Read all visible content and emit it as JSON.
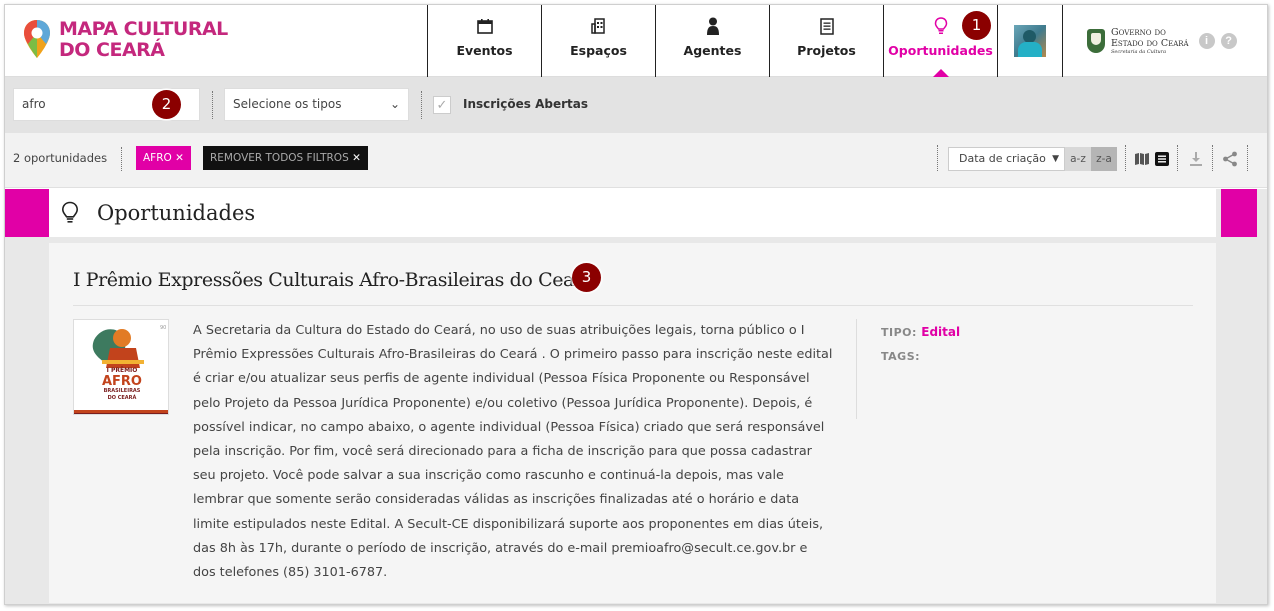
{
  "header": {
    "logo_line1": "MAPA CULTURAL",
    "logo_line2": "DO CEARÁ",
    "nav": [
      {
        "label": "Eventos",
        "icon": "calendar-icon"
      },
      {
        "label": "Espaços",
        "icon": "building-icon"
      },
      {
        "label": "Agentes",
        "icon": "person-icon"
      },
      {
        "label": "Projetos",
        "icon": "document-icon"
      },
      {
        "label": "Oportunidades",
        "icon": "lightbulb-icon",
        "active": true
      }
    ],
    "gov_line1": "Governo do",
    "gov_line2": "Estado do Ceará",
    "gov_line3": "Secretaria da Cultura",
    "info_icon": "i",
    "help_icon": "?"
  },
  "filters": {
    "search_value": "afro",
    "types_placeholder": "Selecione os tipos",
    "open_label": "Inscrições Abertas",
    "open_checked": true
  },
  "results": {
    "count_text": "2 oportunidades",
    "chip_afro": "AFRO",
    "chip_clear": "REMOVER TODOS FILTROS",
    "sort_label": "Data de criação",
    "sort_az": "a-z",
    "sort_za": "z-a"
  },
  "section": {
    "title": "Oportunidades"
  },
  "opportunity": {
    "title": "I Prêmio Expressões Culturais Afro-Brasileiras do Ceará",
    "thumb_number": "90",
    "thumb_line1": "I PRÊMIO",
    "thumb_line2": "AFRO",
    "thumb_line3": "BRASILEIRAS",
    "thumb_line4": "DO CEARÁ",
    "description": "A Secretaria da Cultura do Estado do Ceará, no uso de suas atribuições legais, torna público o  I Prêmio Expressões Culturais Afro-Brasileiras do Ceará . O primeiro passo para inscrição neste edital é criar e/ou atualizar seus perfis de agente individual (Pessoa Física Proponente ou Responsável pelo Projeto da Pessoa Jurídica Proponente) e/ou coletivo (Pessoa Jurídica Proponente). Depois, é possível indicar, no campo abaixo, o agente individual (Pessoa Física) criado que será responsável pela inscrição. Por fim, você será direcionado para a ficha de inscrição para que possa cadastrar seu projeto. Você pode salvar a sua inscrição como rascunho e continuá-la depois, mas vale lembrar que somente serão consideradas válidas as inscrições finalizadas até o horário e data limite estipulados neste Edital. A Secult-CE disponibilizará suporte aos proponentes em dias úteis, das 8h às 17h, durante o período de inscrição, através do e-mail premioafro@secult.ce.gov.br e dos telefones (85) 3101-6787.",
    "tipo_label": "TIPO:",
    "tipo_value": "Edital",
    "tags_label": "TAGS:"
  },
  "markers": [
    "1",
    "2",
    "3"
  ],
  "colors": {
    "accent": "#e100a6",
    "marker": "#8b0000",
    "logo": "#c4287d"
  }
}
